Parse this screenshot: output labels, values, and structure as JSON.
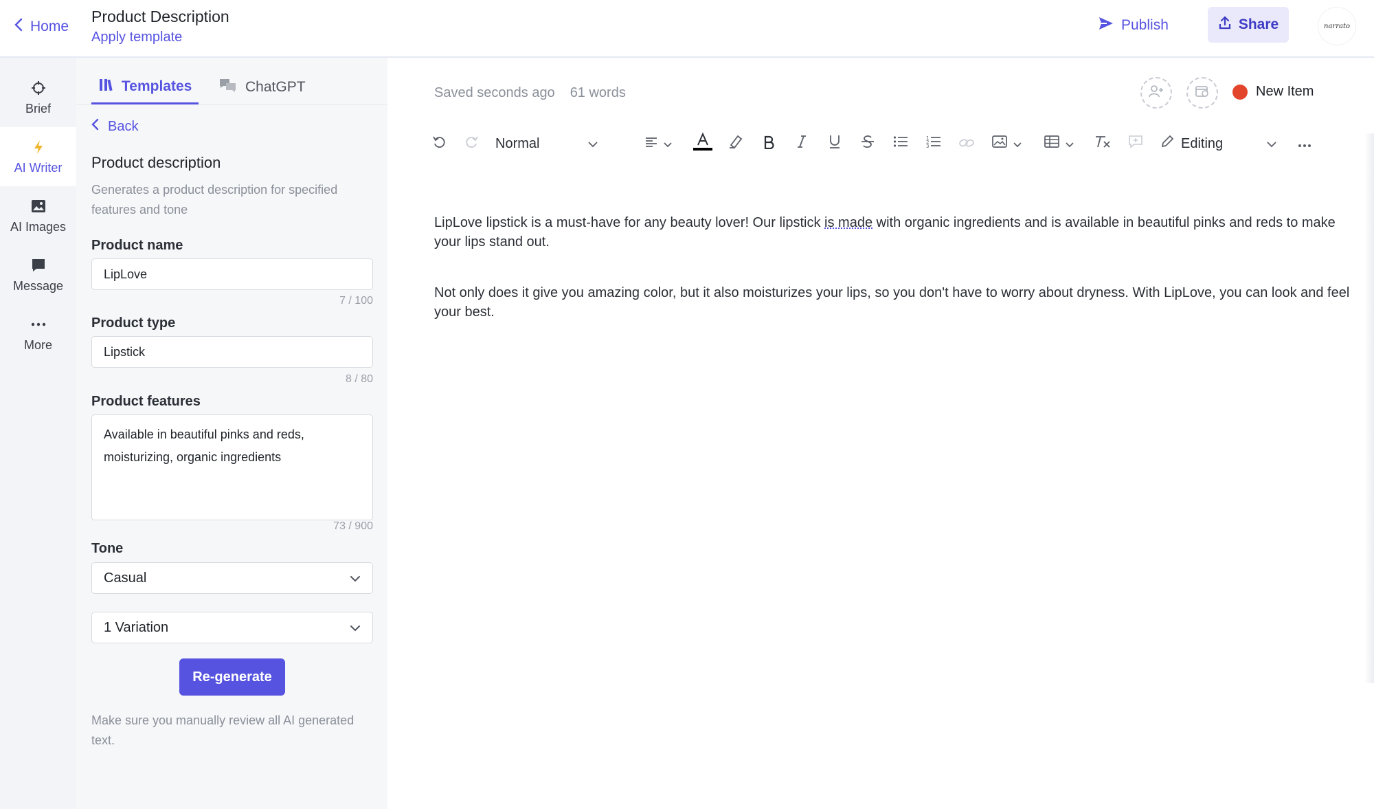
{
  "topbar": {
    "home_label": "Home",
    "doc_title": "Product Description",
    "apply_template": "Apply template",
    "publish_label": "Publish",
    "share_label": "Share",
    "logo_text": "narrato"
  },
  "rail": {
    "items": [
      {
        "label": "Brief",
        "icon": "crosshair-icon"
      },
      {
        "label": "AI Writer",
        "icon": "lightning-icon"
      },
      {
        "label": "AI Images",
        "icon": "image-icon"
      },
      {
        "label": "Message",
        "icon": "message-icon"
      },
      {
        "label": "More",
        "icon": "more-dots-icon"
      }
    ]
  },
  "panel": {
    "tabs": [
      {
        "label": "Templates",
        "icon": "templates-icon",
        "active": true
      },
      {
        "label": "ChatGPT",
        "icon": "chat-icon",
        "active": false
      }
    ],
    "back_label": "Back",
    "title": "Product description",
    "description": "Generates a product description for specified features and tone",
    "product_name": {
      "label": "Product name",
      "value": "LipLove",
      "counter": "7 / 100"
    },
    "product_type": {
      "label": "Product type",
      "value": "Lipstick",
      "counter": "8 / 80"
    },
    "product_features": {
      "label": "Product features",
      "value": "Available in beautiful pinks and reds, moisturizing, organic ingredients",
      "counter": "73 / 900"
    },
    "tone": {
      "label": "Tone",
      "value": "Casual"
    },
    "variations": {
      "value": "1 Variation"
    },
    "regenerate_label": "Re-generate",
    "disclaimer": "Make sure you manually review all AI generated text."
  },
  "editor": {
    "saved_status": "Saved seconds ago",
    "word_count": "61 words",
    "new_item_label": "New Item",
    "toolbar": {
      "style_value": "Normal",
      "mode_value": "Editing"
    },
    "paragraphs": [
      {
        "before": "LipLove lipstick is a must-have for any beauty lover! Our lipstick ",
        "flagged": "is made",
        "after": " with organic ingredients and is available in beautiful pinks and reds to make your lips stand out."
      },
      {
        "text": "Not only does it give you amazing color, but it also moisturizes your lips, so you don't have to worry about dryness. With LipLove, you can look and feel your best."
      }
    ]
  },
  "colors": {
    "accent": "#5653e0",
    "new_item_dot": "#e2452b",
    "rail_bg": "#f3f4f7",
    "panel_bg": "#f6f7f9"
  }
}
